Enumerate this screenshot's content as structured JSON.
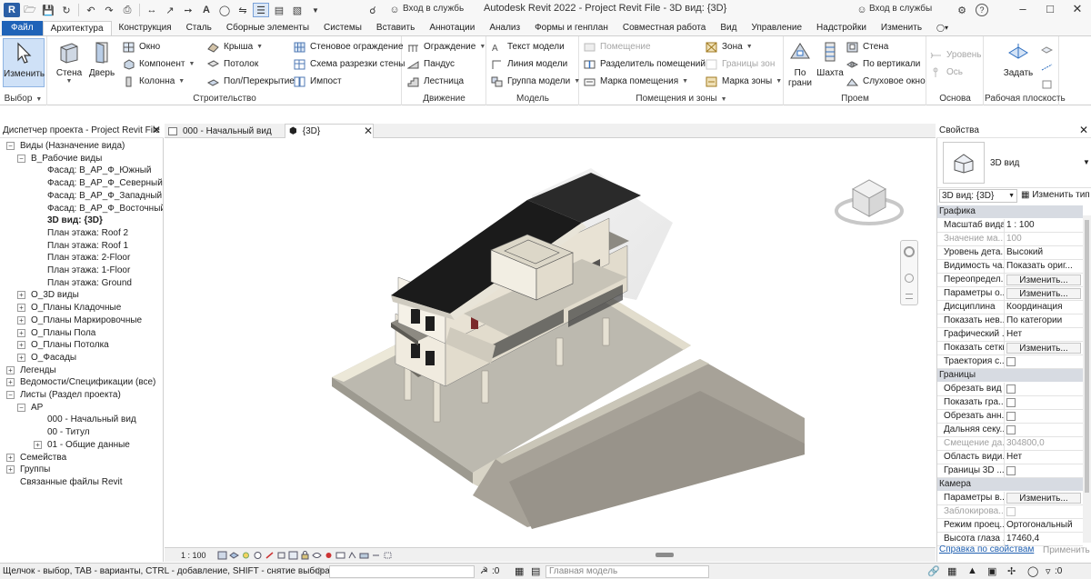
{
  "app": {
    "title": "Autodesk Revit 2022 - Project Revit File - 3D вид: {3D}",
    "sign_in": "Вход в службь",
    "sign_in_right": "Вход в службы",
    "help": "?"
  },
  "tabs": [
    "Файл",
    "Архитектура",
    "Конструкция",
    "Сталь",
    "Сборные элементы",
    "Системы",
    "Вставить",
    "Аннотации",
    "Анализ",
    "Формы и генплан",
    "Совместная работа",
    "Вид",
    "Управление",
    "Надстройки",
    "Изменить"
  ],
  "ribbon": {
    "select": {
      "button": "Изменить",
      "title": "Выбор"
    },
    "build": {
      "title": "Строительство",
      "wall": "Стена",
      "door": "Дверь",
      "window": "Окно",
      "component": "Компонент",
      "column": "Колонна",
      "roof": "Крыша",
      "ceiling": "Потолок",
      "floor": "Пол/Перекрытие",
      "curtain_system": "Стеновое ограждение",
      "curtain_grid": "Схема разрезки стены",
      "mullion": "Импост"
    },
    "circulation": {
      "title": "Движение",
      "railing": "Ограждение",
      "ramp": "Пандус",
      "stair": "Лестница"
    },
    "model": {
      "title": "Модель",
      "text": "Текст модели",
      "line": "Линия модели",
      "group": "Группа модели"
    },
    "rooms": {
      "title": "Помещения и зоны",
      "room": "Помещение",
      "separator": "Разделитель помещений",
      "tag_room": "Марка помещения",
      "area": "Зона",
      "area_boundary": "Границы зон",
      "tag_area": "Марка зоны"
    },
    "opening": {
      "title": "Проем",
      "face": "По грани",
      "shaft": "Шахта",
      "wall": "Стена",
      "vertical": "По вертикали",
      "dormer": "Слуховое окно"
    },
    "datum": {
      "title": "Основа",
      "level": "Уровень",
      "grid": "Ось"
    },
    "workplane": {
      "title": "Рабочая плоскость",
      "set": "Задать"
    }
  },
  "project_browser": {
    "title": "Диспетчер проекта - Project Revit File",
    "items": [
      {
        "label": "Виды (Назначение вида)",
        "level": 0,
        "toggle": "-"
      },
      {
        "label": "В_Рабочие виды",
        "level": 1,
        "toggle": "-"
      },
      {
        "label": "Фасад: В_АР_Ф_Южный",
        "level": 2,
        "toggle": ""
      },
      {
        "label": "Фасад: В_АР_Ф_Северный",
        "level": 2,
        "toggle": ""
      },
      {
        "label": "Фасад: В_АР_Ф_Западный",
        "level": 2,
        "toggle": ""
      },
      {
        "label": "Фасад: В_АР_Ф_Восточный",
        "level": 2,
        "toggle": ""
      },
      {
        "label": "3D вид: {3D}",
        "level": 2,
        "toggle": "",
        "bold": true
      },
      {
        "label": "План этажа: Roof 2",
        "level": 2,
        "toggle": ""
      },
      {
        "label": "План этажа: Roof 1",
        "level": 2,
        "toggle": ""
      },
      {
        "label": "План этажа: 2-Floor",
        "level": 2,
        "toggle": ""
      },
      {
        "label": "План этажа: 1-Floor",
        "level": 2,
        "toggle": ""
      },
      {
        "label": "План этажа: Ground",
        "level": 2,
        "toggle": ""
      },
      {
        "label": "О_3D виды",
        "level": 1,
        "toggle": "+"
      },
      {
        "label": "О_Планы Кладочные",
        "level": 1,
        "toggle": "+"
      },
      {
        "label": "О_Планы Маркировочные",
        "level": 1,
        "toggle": "+"
      },
      {
        "label": "О_Планы Пола",
        "level": 1,
        "toggle": "+"
      },
      {
        "label": "О_Планы Потолка",
        "level": 1,
        "toggle": "+"
      },
      {
        "label": "О_Фасады",
        "level": 1,
        "toggle": "+"
      },
      {
        "label": "Легенды",
        "level": 0,
        "toggle": "+"
      },
      {
        "label": "Ведомости/Спецификации (все)",
        "level": 0,
        "toggle": "+"
      },
      {
        "label": "Листы (Раздел проекта)",
        "level": 0,
        "toggle": "-"
      },
      {
        "label": "АР",
        "level": 1,
        "toggle": "-"
      },
      {
        "label": "000 - Начальный вид",
        "level": 2,
        "toggle": ""
      },
      {
        "label": "00 - Титул",
        "level": 2,
        "toggle": ""
      },
      {
        "label": "01 - Общие данные",
        "level": 2,
        "toggle": "+"
      },
      {
        "label": "Семейства",
        "level": 0,
        "toggle": "+"
      },
      {
        "label": "Группы",
        "level": 0,
        "toggle": "+"
      },
      {
        "label": "Связанные файлы Revit",
        "level": 0,
        "toggle": ""
      }
    ]
  },
  "view_tabs": [
    {
      "label": "000 - Начальный вид",
      "active": false
    },
    {
      "label": "{3D}",
      "active": true
    }
  ],
  "view_control": {
    "scale": "1 : 100"
  },
  "properties": {
    "title": "Свойства",
    "type_name": "3D вид",
    "selector": "3D вид: {3D}",
    "edit_type": "Изменить тип",
    "sections": [
      {
        "name": "Графика",
        "rows": [
          {
            "k": "Масштаб вида",
            "v": "1 : 100",
            "kind": "text"
          },
          {
            "k": "Значение ма...",
            "v": "100",
            "kind": "dis"
          },
          {
            "k": "Уровень дета...",
            "v": "Высокий",
            "kind": "text"
          },
          {
            "k": "Видимость ча...",
            "v": "Показать ориг...",
            "kind": "text"
          },
          {
            "k": "Переопредел...",
            "v": "Изменить...",
            "kind": "btn"
          },
          {
            "k": "Параметры о...",
            "v": "Изменить...",
            "kind": "btn"
          },
          {
            "k": "Дисциплина",
            "v": "Координация",
            "kind": "text"
          },
          {
            "k": "Показать нев...",
            "v": "По категории",
            "kind": "text"
          },
          {
            "k": "Графический ...",
            "v": "Нет",
            "kind": "text"
          },
          {
            "k": "Показать сетки",
            "v": "Изменить...",
            "kind": "btn"
          },
          {
            "k": "Траектория с...",
            "v": "",
            "kind": "cb"
          }
        ]
      },
      {
        "name": "Границы",
        "rows": [
          {
            "k": "Обрезать вид",
            "v": "",
            "kind": "cb"
          },
          {
            "k": "Показать гра...",
            "v": "",
            "kind": "cb"
          },
          {
            "k": "Обрезать анн...",
            "v": "",
            "kind": "cb"
          },
          {
            "k": "Дальняя секу...",
            "v": "",
            "kind": "cb"
          },
          {
            "k": "Смещение да...",
            "v": "304800,0",
            "kind": "dis"
          },
          {
            "k": "Область види...",
            "v": "Нет",
            "kind": "text"
          },
          {
            "k": "Границы 3D ...",
            "v": "",
            "kind": "cb"
          }
        ]
      },
      {
        "name": "Камера",
        "rows": [
          {
            "k": "Параметры в...",
            "v": "Изменить...",
            "kind": "btn"
          },
          {
            "k": "Заблокирова...",
            "v": "",
            "kind": "cbdis"
          },
          {
            "k": "Режим проец...",
            "v": "Ортогональный",
            "kind": "text"
          },
          {
            "k": "Высота глаза ...",
            "v": "17460,4",
            "kind": "text"
          }
        ]
      }
    ],
    "help_link": "Справка по свойствам",
    "apply": "Применить"
  },
  "status": {
    "hint": "Щелчок - выбор, TAB - варианты, CTRL - добавление, SHIFT - снятие выбора.",
    "count1": ":0",
    "model": "Главная модель",
    "count2": ":0"
  }
}
